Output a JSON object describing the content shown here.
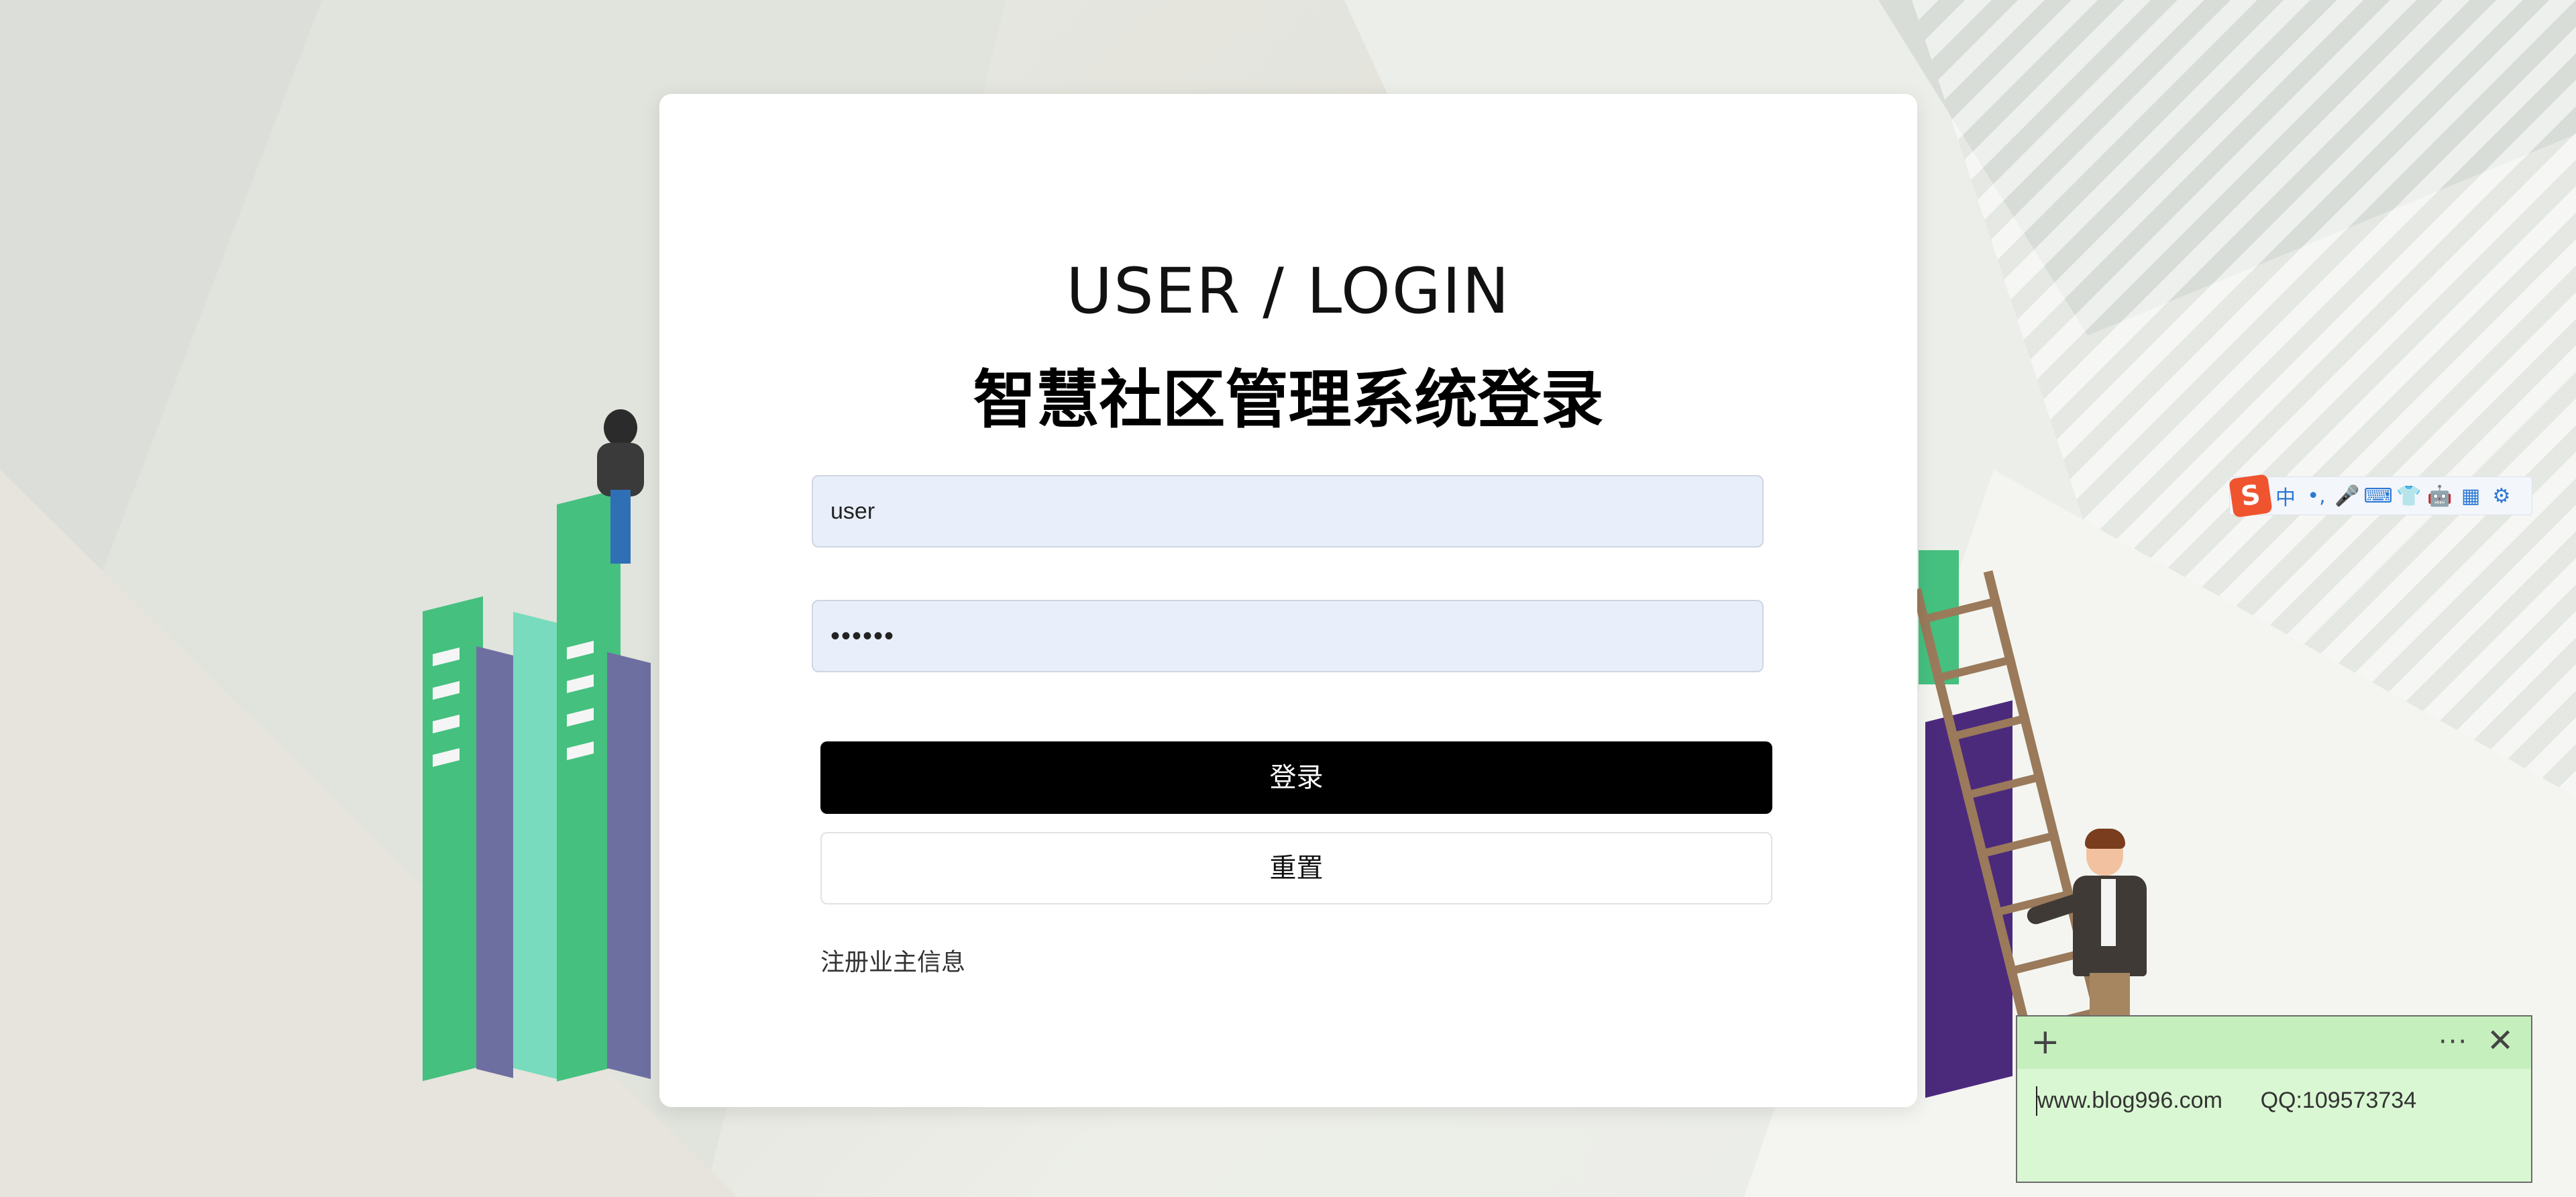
{
  "login_card": {
    "title_en": "USER / LOGIN",
    "title_cn": "智慧社区管理系统登录",
    "username_value": "user",
    "password_masked": "••••••",
    "login_button": "登录",
    "reset_button": "重置",
    "register_link": "注册业主信息"
  },
  "ime_toolbar": {
    "logo": "S",
    "items": [
      "中",
      "•,",
      "🎤",
      "⌨",
      "👕",
      "🤖",
      "▦",
      "⚙"
    ]
  },
  "sticky_note": {
    "add_symbol": "+",
    "more_symbol": "···",
    "close_symbol": "✕",
    "text": "www.blog996.com      QQ:109573734"
  }
}
